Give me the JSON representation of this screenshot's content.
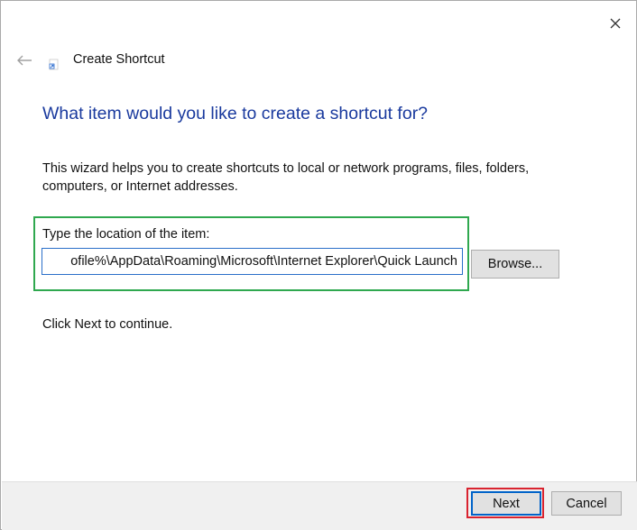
{
  "window": {
    "title": "Create Shortcut",
    "close_icon": "close-icon",
    "back_icon": "back-arrow-icon",
    "app_icon": "shortcut-icon"
  },
  "heading": "What item would you like to create a shortcut for?",
  "description": {
    "line1": "This wizard helps you to create shortcuts to local or network programs, files, folders,",
    "line2": "computers, or Internet addresses."
  },
  "location": {
    "label": "Type the location of the item:",
    "value": "ofile%\\AppData\\Roaming\\Microsoft\\Internet Explorer\\Quick Launch"
  },
  "buttons": {
    "browse": "Browse...",
    "next": "Next",
    "cancel": "Cancel"
  },
  "continue_text": "Click Next to continue.",
  "colors": {
    "heading": "#1a3a9e",
    "highlight_green": "#2fa84f",
    "highlight_red": "#d9232f",
    "focus_blue": "#0063c9"
  }
}
